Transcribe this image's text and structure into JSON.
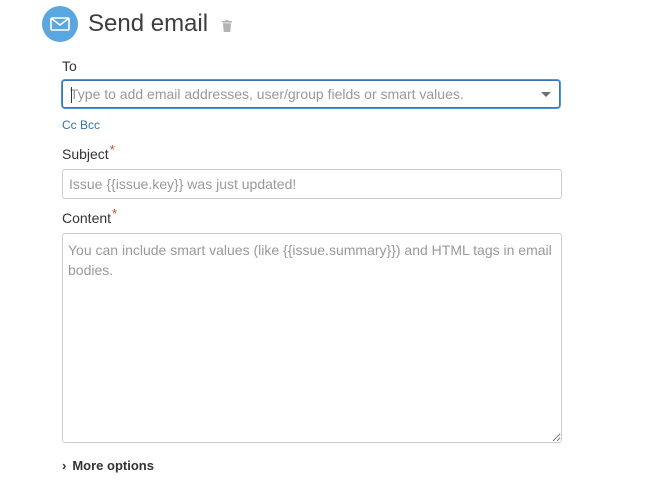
{
  "header": {
    "title": "Send email",
    "icon": "envelope-icon",
    "delete_icon": "trash-icon",
    "accent_color": "#5aa7df"
  },
  "to": {
    "label": "To",
    "placeholder": "Type to add email addresses, user/group fields or smart values.",
    "value": ""
  },
  "cc_bcc": {
    "label": "Cc Bcc"
  },
  "subject": {
    "label": "Subject",
    "required_marker": "*",
    "placeholder": "Issue {{issue.key}} was just updated!",
    "value": ""
  },
  "content": {
    "label": "Content",
    "required_marker": "*",
    "placeholder": "You can include smart values (like {{issue.summary}}) and HTML tags in email bodies.",
    "value": ""
  },
  "more_options": {
    "label": "More options",
    "icon": "chevron-right-icon"
  }
}
